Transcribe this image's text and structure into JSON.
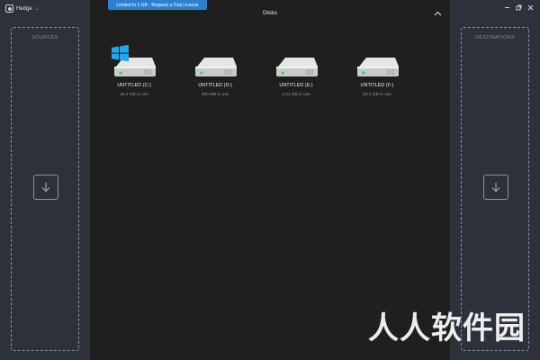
{
  "app": {
    "name": "Hedge",
    "menu_chevron": "⌄",
    "logo_icon": "hedge-logo-icon"
  },
  "window_controls": {
    "minimize_icon": "minimize-icon",
    "restore_icon": "restore-icon",
    "close_icon": "close-icon"
  },
  "license_banner": {
    "text": "Limited to 1 GB - Request a Trial License",
    "color": "#2d7fd0"
  },
  "sources": {
    "label": "SOURCES",
    "drop_icon": "download-arrow-icon"
  },
  "destinations": {
    "label": "DESTINATIONS",
    "drop_icon": "download-arrow-icon"
  },
  "disks_section": {
    "title": "Disks",
    "collapse_icon": "chevron-up-icon",
    "disks": [
      {
        "name": "UNTITLED (C:)",
        "usage": "28.4 GB in use",
        "system": true
      },
      {
        "name": "UNTITLED (D:)",
        "usage": "380 MB in use",
        "system": false
      },
      {
        "name": "UNTITLED (E:)",
        "usage": "1.51 GB in use",
        "system": false
      },
      {
        "name": "UNTITLED (F:)",
        "usage": "63.2 GB in use",
        "system": false
      }
    ]
  },
  "watermark": {
    "text": [
      "人",
      "人",
      "软",
      "件",
      "园"
    ]
  },
  "colors": {
    "sidebar": "#2c313a",
    "main": "#1f1f1f",
    "windows_logo": "#1fa7f0",
    "drive_led": "#3cd35a"
  }
}
